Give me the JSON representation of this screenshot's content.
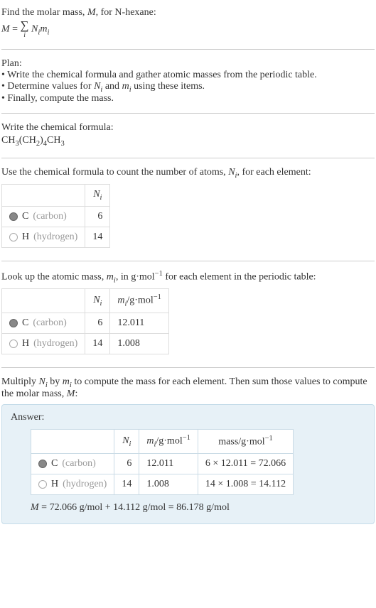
{
  "intro": {
    "line1_pre": "Find the molar mass, ",
    "line1_M": "M",
    "line1_post": ", for N-hexane:",
    "eq_M": "M",
    "eq_eq": " = ",
    "eq_Ni": "N",
    "eq_i1": "i",
    "eq_mi": "m",
    "eq_i2": "i",
    "sigma_sub": "i"
  },
  "plan": {
    "title": "Plan:",
    "b1": "• Write the chemical formula and gather atomic masses from the periodic table.",
    "b2_pre": "• Determine values for ",
    "b2_N": "N",
    "b2_i1": "i",
    "b2_and": " and ",
    "b2_m": "m",
    "b2_i2": "i",
    "b2_post": " using these items.",
    "b3": "• Finally, compute the mass."
  },
  "step1": {
    "title": "Write the chemical formula:",
    "formula_parts": {
      "p1": "CH",
      "s1": "3",
      "p2": "(CH",
      "s2": "2",
      "p3": ")",
      "s3": "4",
      "p4": "CH",
      "s4": "3"
    }
  },
  "step2": {
    "title_pre": "Use the chemical formula to count the number of atoms, ",
    "title_N": "N",
    "title_i": "i",
    "title_post": ", for each element:",
    "header_N": "N",
    "header_i": "i",
    "rows": [
      {
        "sym": "C",
        "name": "(carbon)",
        "n": "6"
      },
      {
        "sym": "H",
        "name": "(hydrogen)",
        "n": "14"
      }
    ]
  },
  "step3": {
    "title_pre": "Look up the atomic mass, ",
    "title_m": "m",
    "title_i": "i",
    "title_mid": ", in g·mol",
    "title_exp": "−1",
    "title_post": " for each element in the periodic table:",
    "h_N": "N",
    "h_Ni": "i",
    "h_m": "m",
    "h_mi": "i",
    "h_unit": "/g·mol",
    "h_exp": "−1",
    "rows": [
      {
        "sym": "C",
        "name": "(carbon)",
        "n": "6",
        "m": "12.011"
      },
      {
        "sym": "H",
        "name": "(hydrogen)",
        "n": "14",
        "m": "1.008"
      }
    ]
  },
  "step4": {
    "title_pre": "Multiply ",
    "title_N": "N",
    "title_Ni": "i",
    "title_by": " by ",
    "title_m": "m",
    "title_mi": "i",
    "title_mid": " to compute the mass for each element. Then sum those values to compute the molar mass, ",
    "title_M": "M",
    "title_post": ":"
  },
  "answer": {
    "label": "Answer:",
    "h_N": "N",
    "h_Ni": "i",
    "h_m": "m",
    "h_mi": "i",
    "h_munit": "/g·mol",
    "h_mexp": "−1",
    "h_mass": "mass/g·mol",
    "h_massexp": "−1",
    "rows": [
      {
        "sym": "C",
        "name": "(carbon)",
        "n": "6",
        "m": "12.011",
        "calc": "6 × 12.011 = 72.066"
      },
      {
        "sym": "H",
        "name": "(hydrogen)",
        "n": "14",
        "m": "1.008",
        "calc": "14 × 1.008 = 14.112"
      }
    ],
    "final_M": "M",
    "final_rest": " = 72.066 g/mol + 14.112 g/mol = 86.178 g/mol"
  }
}
